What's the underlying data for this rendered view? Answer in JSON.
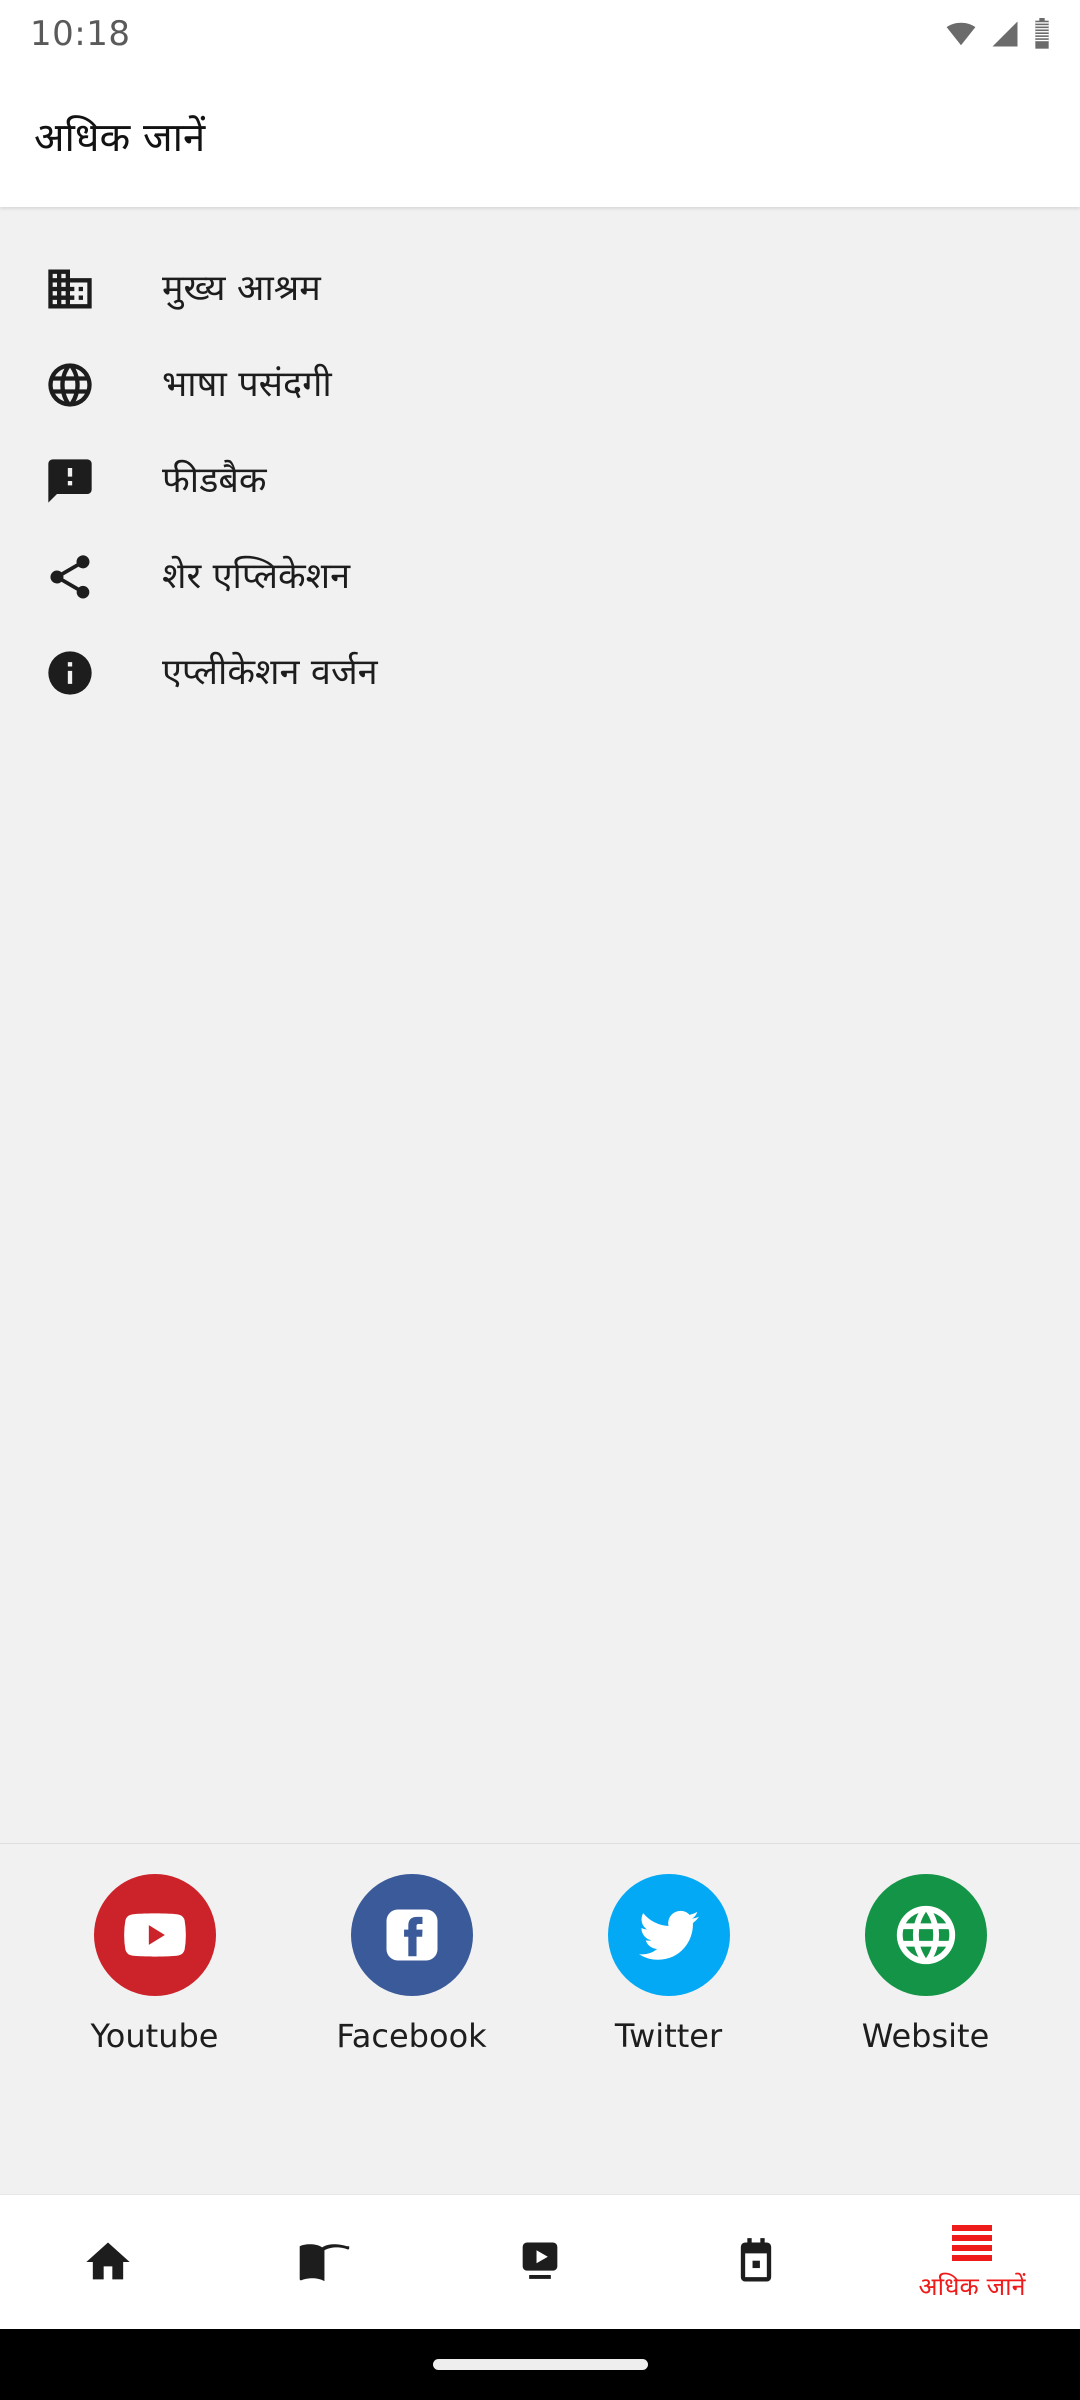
{
  "statusbar": {
    "time": "10:18",
    "icons": [
      "wifi-icon",
      "cellular-signal-icon",
      "battery-icon"
    ]
  },
  "appbar": {
    "title": "अधिक जानें"
  },
  "menu": {
    "items": [
      {
        "icon": "building-icon",
        "label": "मुख्य आश्रम"
      },
      {
        "icon": "globe-icon",
        "label": "भाषा पसंदगी"
      },
      {
        "icon": "feedback-icon",
        "label": "फीडबैक"
      },
      {
        "icon": "share-icon",
        "label": "शेर एप्लिकेशन"
      },
      {
        "icon": "info-icon",
        "label": "एप्लीकेशन वर्जन"
      }
    ]
  },
  "social": {
    "items": [
      {
        "icon": "youtube-icon",
        "label": "Youtube",
        "color": "#cc2229"
      },
      {
        "icon": "facebook-icon",
        "label": "Facebook",
        "color": "#3b5a9a"
      },
      {
        "icon": "twitter-icon",
        "label": "Twitter",
        "color": "#03a9f4"
      },
      {
        "icon": "website-icon",
        "label": "Website",
        "color": "#149447"
      }
    ]
  },
  "bottomnav": {
    "active_color": "#ef1b1b",
    "inactive_color": "#1d1d1d",
    "items": [
      {
        "icon": "home-icon",
        "label": "",
        "active": false
      },
      {
        "icon": "book-icon",
        "label": "",
        "active": false
      },
      {
        "icon": "video-icon",
        "label": "",
        "active": false
      },
      {
        "icon": "calendar-icon",
        "label": "",
        "active": false
      },
      {
        "icon": "hamburger-icon",
        "label": "अधिक जानें",
        "active": true
      }
    ]
  }
}
